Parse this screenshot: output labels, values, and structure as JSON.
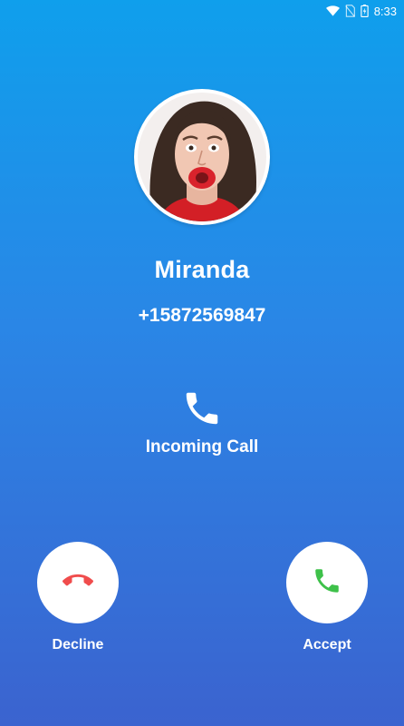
{
  "status_bar": {
    "time": "8:33",
    "icons": [
      "wifi-icon",
      "no-sim-icon",
      "battery-icon"
    ]
  },
  "caller": {
    "name": "Miranda",
    "number": "+15872569847",
    "avatar": "contact-photo"
  },
  "call": {
    "status_label": "Incoming Call",
    "status_icon": "phone-icon"
  },
  "actions": {
    "decline_label": "Decline",
    "accept_label": "Accept"
  },
  "colors": {
    "background_top": "#0f9fec",
    "background_bottom": "#3b63cf",
    "decline": "#f04c4c",
    "accept": "#3ec14a"
  }
}
